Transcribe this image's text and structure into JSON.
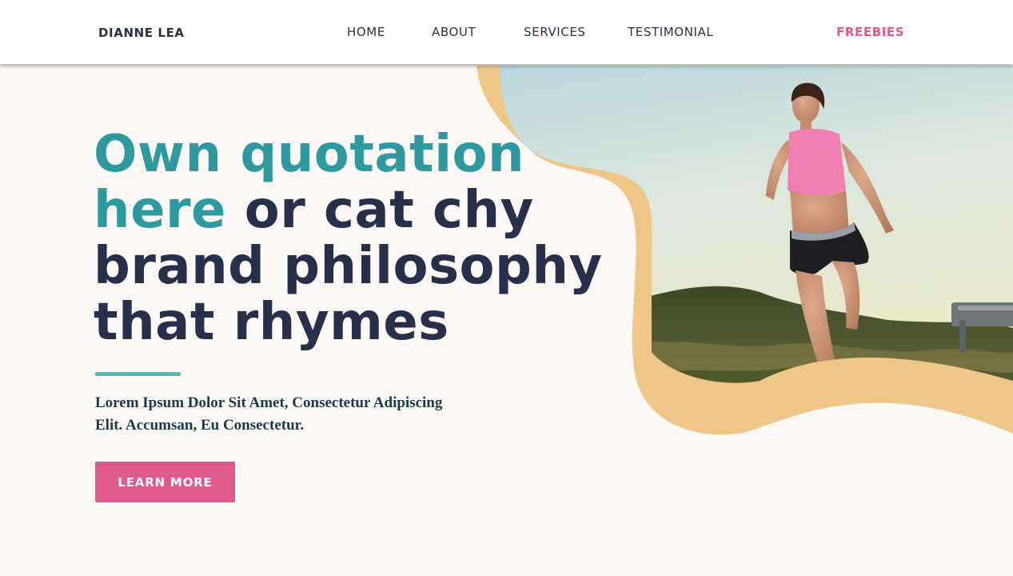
{
  "header": {
    "brand": "DIANNE LEA",
    "nav": {
      "home": "HOME",
      "about": "ABOUT",
      "services": "SERVICES",
      "testimonial": "TESTIMONIAL",
      "freebies": "FREEBIES"
    }
  },
  "hero": {
    "headline_accent_1": "Own quotation",
    "headline_accent_2": "here",
    "headline_rest_1": " or cat chy",
    "headline_rest_2": "brand philosophy",
    "headline_rest_3": "that rhymes",
    "subtext": "Lorem Ipsum Dolor Sit Amet, Consectetur Adipiscing Elit. Accumsan, Eu Consectetur.",
    "cta_label": "LEARN MORE",
    "image_subject": "woman-running-outdoors-photo"
  },
  "colors": {
    "brand_dark": "#27304a",
    "accent_teal": "#2f99a0",
    "accent_pink": "#df5b8b",
    "blob_gold": "#eec688",
    "background": "#fcf8f5"
  }
}
